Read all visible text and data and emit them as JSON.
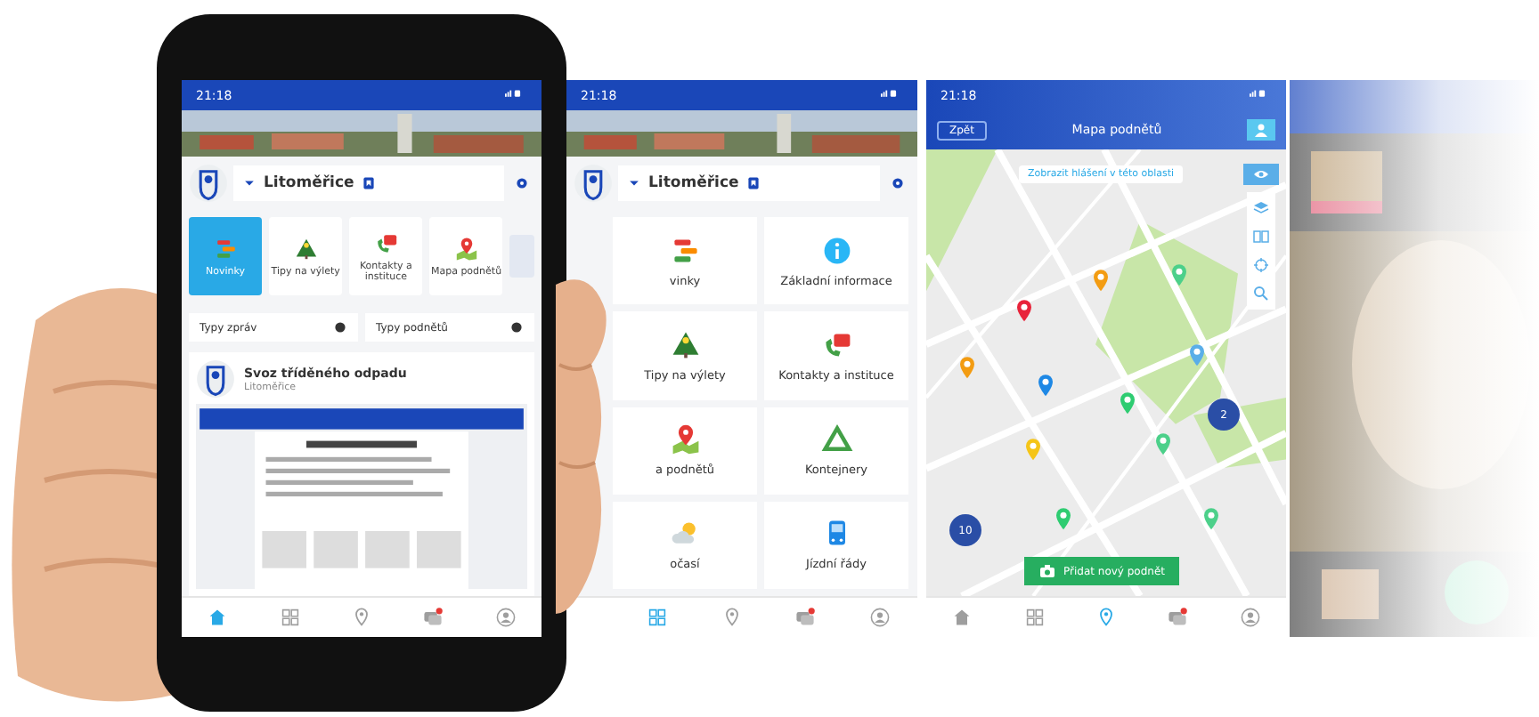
{
  "phone_screen": {
    "status_time": "21:18",
    "city": "Litoměřice",
    "tiles": [
      {
        "label": "Novinky",
        "selected": true
      },
      {
        "label": "Tipy na výlety",
        "selected": false
      },
      {
        "label": "Kontakty a instituce",
        "selected": false
      },
      {
        "label": "Mapa podnětů",
        "selected": false
      }
    ],
    "filters": [
      {
        "label": "Typy zpráv"
      },
      {
        "label": "Typy podnětů"
      }
    ],
    "news": {
      "title": "Svoz tříděného odpadu",
      "place": "Litoměřice"
    },
    "nav": [
      {
        "selected": true
      },
      {
        "selected": false
      },
      {
        "selected": false
      },
      {
        "selected": false
      },
      {
        "selected": false
      }
    ]
  },
  "menu_screen": {
    "status_time": "21:18",
    "city": "Litoměřice",
    "cards": [
      {
        "label": "vinky"
      },
      {
        "label": "Základní informace"
      },
      {
        "label": "Tipy na výlety"
      },
      {
        "label": "Kontakty a instituce"
      },
      {
        "label": "a podnětů"
      },
      {
        "label": "Kontejnery"
      },
      {
        "label": "očasí"
      },
      {
        "label": "Jízdní řády"
      }
    ],
    "nav": [
      {
        "selected": true
      },
      {
        "selected": false
      },
      {
        "selected": false
      },
      {
        "selected": false
      }
    ]
  },
  "map_screen": {
    "status_time": "21:18",
    "back": "Zpět",
    "title": "Mapa podnětů",
    "area_button": "Zobrazit hlášení v této oblasti",
    "markers": [
      {
        "color": "#f39c12"
      },
      {
        "color": "#4cd08a"
      },
      {
        "color": "#e8233a"
      },
      {
        "color": "#f39c12"
      },
      {
        "color": "#1e88e5"
      },
      {
        "color": "#5aaee8"
      },
      {
        "color": "#2ecc71"
      },
      {
        "color": "#4cd08a"
      },
      {
        "color": "#f5c518"
      },
      {
        "color": "#2ecc71"
      },
      {
        "color": "#4cd08a"
      }
    ],
    "clusters": [
      {
        "count": "2"
      },
      {
        "count": "10"
      }
    ],
    "add_button": "Přidat nový podnět",
    "nav": [
      {
        "selected": false
      },
      {
        "selected": false
      },
      {
        "selected": true
      },
      {
        "selected": false
      },
      {
        "selected": false
      }
    ]
  }
}
